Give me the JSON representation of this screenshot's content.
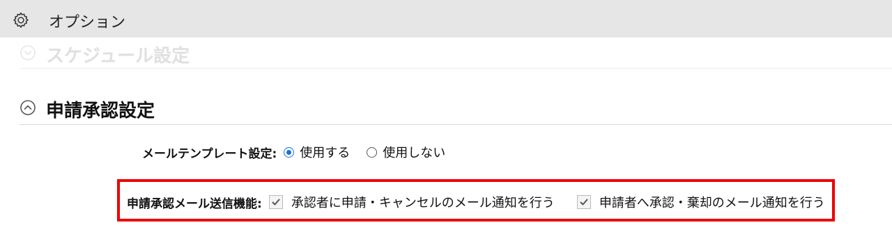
{
  "header": {
    "title": "オプション",
    "icon": "gear-icon"
  },
  "sections": {
    "schedule": {
      "label": "スケジュール設定",
      "state": "collapsed",
      "icon": "chevron-down-icon"
    },
    "approval": {
      "label": "申請承認設定",
      "state": "expanded",
      "icon": "chevron-up-icon"
    }
  },
  "mail_template": {
    "label": "メールテンプレート設定:",
    "options": [
      {
        "label": "使用する",
        "selected": true
      },
      {
        "label": "使用しない",
        "selected": false
      }
    ]
  },
  "mail_send": {
    "label": "申請承認メール送信機能:",
    "checkboxes": [
      {
        "label": "承認者に申請・キャンセルのメール通知を行う",
        "checked": true
      },
      {
        "label": "申請者へ承認・棄却のメール通知を行う",
        "checked": true
      }
    ]
  },
  "colors": {
    "highlight": "#ee0000",
    "radio_accent": "#1a6fd8",
    "topbar_bg": "#e6e6e6"
  }
}
